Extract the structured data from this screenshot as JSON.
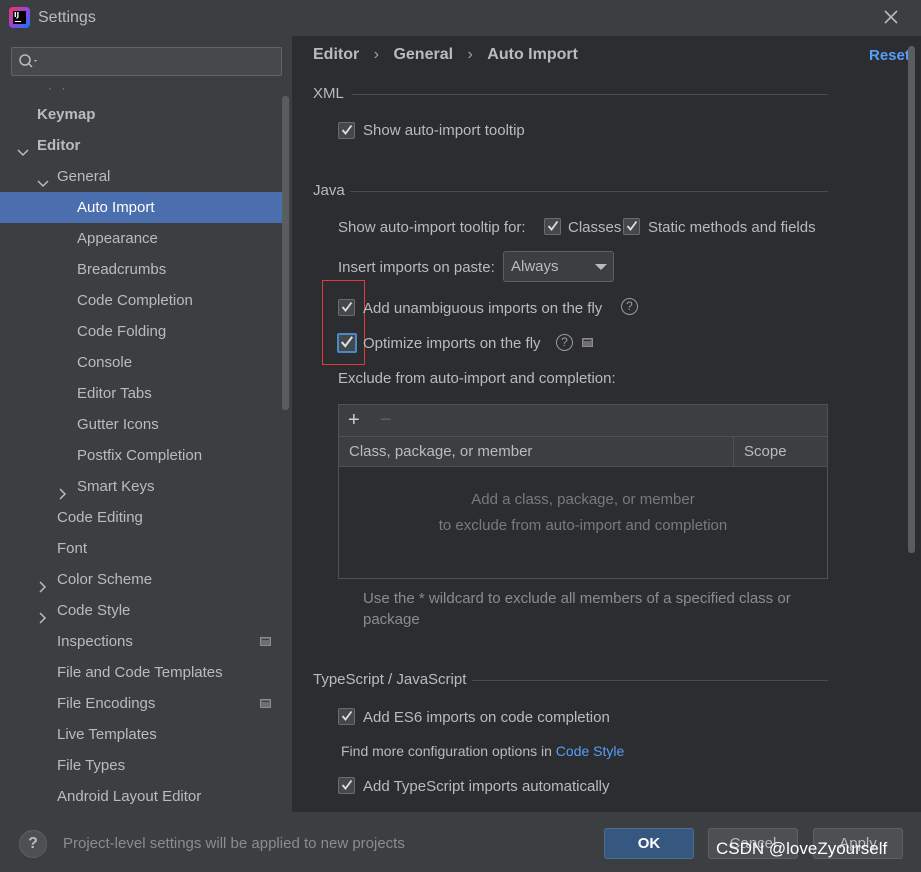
{
  "window": {
    "title": "Settings"
  },
  "sidebar": {
    "search": {
      "placeholder": "",
      "value": ""
    },
    "items": [
      {
        "label": "Keymap"
      },
      {
        "label": "Editor"
      },
      {
        "label": "General"
      },
      {
        "label": "Auto Import"
      },
      {
        "label": "Appearance"
      },
      {
        "label": "Breadcrumbs"
      },
      {
        "label": "Code Completion"
      },
      {
        "label": "Code Folding"
      },
      {
        "label": "Console"
      },
      {
        "label": "Editor Tabs"
      },
      {
        "label": "Gutter Icons"
      },
      {
        "label": "Postfix Completion"
      },
      {
        "label": "Smart Keys"
      },
      {
        "label": "Code Editing"
      },
      {
        "label": "Font"
      },
      {
        "label": "Color Scheme"
      },
      {
        "label": "Code Style"
      },
      {
        "label": "Inspections"
      },
      {
        "label": "File and Code Templates"
      },
      {
        "label": "File Encodings"
      },
      {
        "label": "Live Templates"
      },
      {
        "label": "File Types"
      },
      {
        "label": "Android Layout Editor"
      }
    ]
  },
  "breadcrumb": [
    "Editor",
    "General",
    "Auto Import"
  ],
  "breadcrumb_separator": "›",
  "reset_label": "Reset",
  "xml": {
    "title": "XML",
    "show_tooltip": {
      "label": "Show auto-import tooltip",
      "checked": true
    }
  },
  "java": {
    "title": "Java",
    "tooltip_for_label": "Show auto-import tooltip for:",
    "classes": {
      "label": "Classes",
      "checked": true
    },
    "static_methods": {
      "label": "Static methods and fields",
      "checked": true
    },
    "insert_on_paste_label": "Insert imports on paste:",
    "insert_on_paste_value": "Always",
    "unambiguous": {
      "label": "Add unambiguous imports on the fly",
      "checked": true
    },
    "optimize": {
      "label": "Optimize imports on the fly",
      "checked": true
    },
    "exclude_label": "Exclude from auto-import and completion:",
    "table": {
      "add_symbol": "+",
      "remove_symbol": "−",
      "columns": [
        "Class, package, or member",
        "Scope"
      ],
      "empty_line1": "Add a class, package, or member",
      "empty_line2": "to exclude from auto-import and completion"
    },
    "hint": "Use the * wildcard to exclude all members of a specified class or package"
  },
  "typescript": {
    "title": "TypeScript / JavaScript",
    "es6": {
      "label": "Add ES6 imports on code completion",
      "checked": true
    },
    "more_config_prefix": "Find more configuration options in ",
    "more_config_link": "Code Style",
    "ts_auto": {
      "label": "Add TypeScript imports automatically",
      "checked": true
    }
  },
  "footer": {
    "help_symbol": "?",
    "status": "Project-level settings will be applied to new projects",
    "ok_label": "OK",
    "cancel_label": "Cancel",
    "apply_label": "Apply"
  },
  "watermark": "CSDN @loveZyourself",
  "colors": {
    "background": "#2b2d30",
    "panel": "#3c3f41",
    "selection": "#4b6eaf",
    "link": "#589df6",
    "ok_button": "#365880",
    "highlight_box": "#e03b3b"
  }
}
